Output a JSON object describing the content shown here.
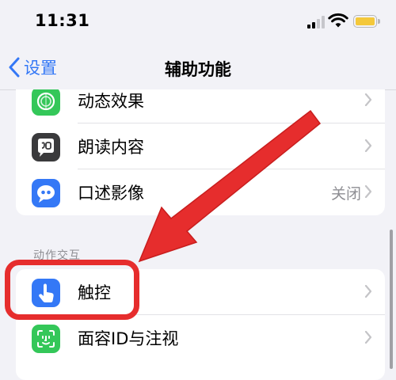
{
  "status_bar": {
    "time": "11:31"
  },
  "nav": {
    "back_label": "设置",
    "title": "辅助功能"
  },
  "vision_group": {
    "items": [
      {
        "label": "动态效果",
        "value": "",
        "icon": "motion-icon",
        "color": "#34c759"
      },
      {
        "label": "朗读内容",
        "value": "",
        "icon": "speech-bubble-icon",
        "color": "#3a3a3c"
      },
      {
        "label": "口述影像",
        "value": "关闭",
        "icon": "quote-bubble-icon",
        "color": "#3478f6"
      }
    ]
  },
  "interaction_section": {
    "header": "动作交互",
    "items": [
      {
        "label": "触控",
        "value": "",
        "icon": "hand-pointer-icon",
        "color": "#3478f6"
      },
      {
        "label": "面容ID与注视",
        "value": "",
        "icon": "face-id-icon",
        "color": "#34c759"
      }
    ]
  },
  "colors": {
    "accent": "#3478f6",
    "annotation_red": "#e62d2d"
  }
}
